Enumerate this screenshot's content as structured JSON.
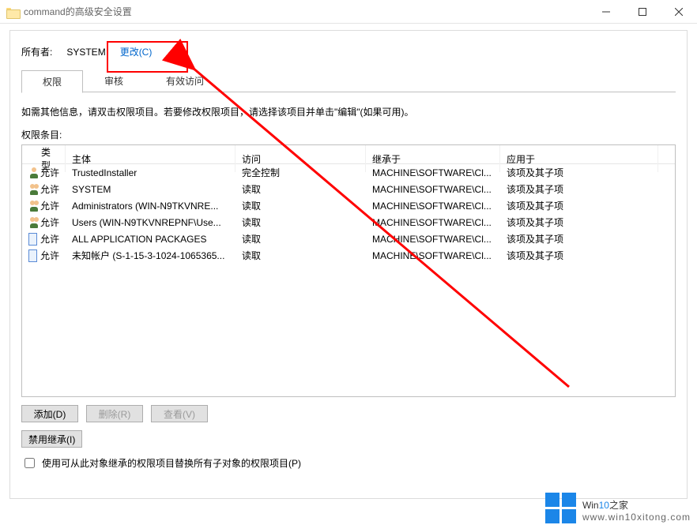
{
  "window": {
    "title": "command的高级安全设置"
  },
  "owner": {
    "label": "所有者:",
    "value": "SYSTEM",
    "change_link": "更改(C)"
  },
  "tabs": {
    "permissions": "权限",
    "auditing": "审核",
    "effective": "有效访问"
  },
  "info_text": "如需其他信息，请双击权限项目。若要修改权限项目，请选择该项目并单击\"编辑\"(如果可用)。",
  "entries_label": "权限条目:",
  "columns": {
    "type": "类型",
    "principal": "主体",
    "access": "访问",
    "inherited": "继承于",
    "applies": "应用于"
  },
  "rows": [
    {
      "icon": "user",
      "type": "允许",
      "principal": "TrustedInstaller",
      "access": "完全控制",
      "inherited": "MACHINE\\SOFTWARE\\Cl...",
      "applies": "该项及其子项"
    },
    {
      "icon": "multi",
      "type": "允许",
      "principal": "SYSTEM",
      "access": "读取",
      "inherited": "MACHINE\\SOFTWARE\\Cl...",
      "applies": "该项及其子项"
    },
    {
      "icon": "multi",
      "type": "允许",
      "principal": "Administrators (WIN-N9TKVNRE...",
      "access": "读取",
      "inherited": "MACHINE\\SOFTWARE\\Cl...",
      "applies": "该项及其子项"
    },
    {
      "icon": "multi",
      "type": "允许",
      "principal": "Users (WIN-N9TKVNREPNF\\Use...",
      "access": "读取",
      "inherited": "MACHINE\\SOFTWARE\\Cl...",
      "applies": "该项及其子项"
    },
    {
      "icon": "gen",
      "type": "允许",
      "principal": "ALL APPLICATION PACKAGES",
      "access": "读取",
      "inherited": "MACHINE\\SOFTWARE\\Cl...",
      "applies": "该项及其子项"
    },
    {
      "icon": "gen",
      "type": "允许",
      "principal": "未知帐户 (S-1-15-3-1024-1065365...",
      "access": "读取",
      "inherited": "MACHINE\\SOFTWARE\\Cl...",
      "applies": "该项及其子项"
    }
  ],
  "buttons": {
    "add": "添加(D)",
    "remove": "删除(R)",
    "view": "查看(V)",
    "disable_inherit": "禁用继承(I)"
  },
  "checkbox_label": "使用可从此对象继承的权限项目替换所有子对象的权限项目(P)",
  "watermark": {
    "brand_pre": "Win",
    "brand_num": "10",
    "brand_post": "之家",
    "url": "www.win10xitong.com"
  }
}
